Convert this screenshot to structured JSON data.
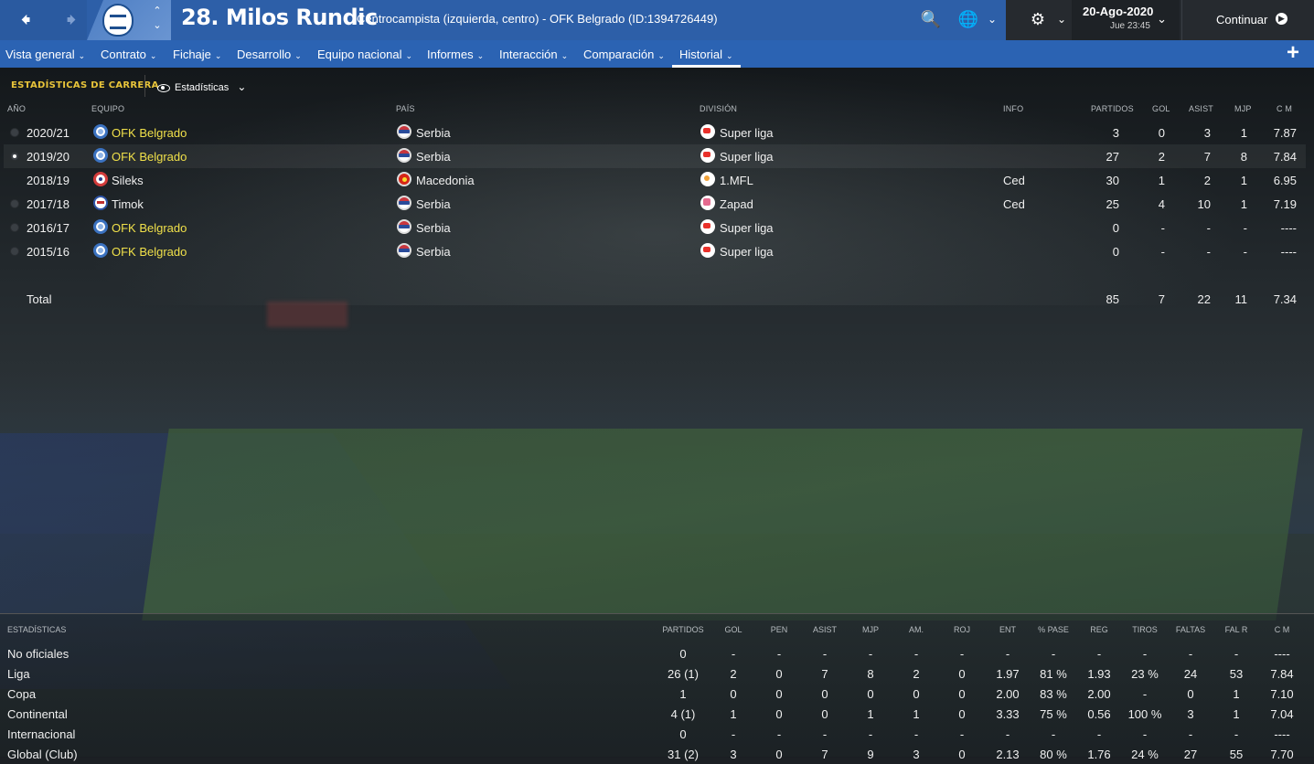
{
  "header": {
    "player_name": "28. Milos Rundic",
    "player_subtitle": "Centrocampista (izquierda, centro) - OFK Belgrado (ID:1394726449)",
    "date": "20-Ago-2020",
    "time": "Jue 23:45",
    "continue_label": "Continuar"
  },
  "menu": {
    "items": [
      "Vista general",
      "Contrato",
      "Fichaje",
      "Desarrollo",
      "Equipo nacional",
      "Informes",
      "Interacción",
      "Comparación",
      "Historial"
    ],
    "active": "Historial"
  },
  "career": {
    "title": "ESTADÍSTICAS DE CARRERA",
    "view": "Estadísticas",
    "columns": {
      "year": "AÑO",
      "team": "EQUIPO",
      "country": "PAÍS",
      "division": "DIVISIÓN",
      "info": "INFO",
      "apps": "PARTIDOS",
      "goals": "GOL",
      "assists": "ASIST",
      "pom": "MJP",
      "avg": "C M"
    },
    "rows": [
      {
        "year": "2020/21",
        "team": "OFK Belgrado",
        "country": "Serbia",
        "division": "Super liga",
        "info": "",
        "apps": "3",
        "goals": "0",
        "assists": "3",
        "pom": "1",
        "avg": "7.87"
      },
      {
        "year": "2019/20",
        "team": "OFK Belgrado",
        "country": "Serbia",
        "division": "Super liga",
        "info": "",
        "apps": "27",
        "goals": "2",
        "assists": "7",
        "pom": "8",
        "avg": "7.84"
      },
      {
        "year": "2018/19",
        "team": "Sileks",
        "country": "Macedonia",
        "division": "1.MFL",
        "info": "Ced",
        "apps": "30",
        "goals": "1",
        "assists": "2",
        "pom": "1",
        "avg": "6.95"
      },
      {
        "year": "2017/18",
        "team": "Timok",
        "country": "Serbia",
        "division": "Zapad",
        "info": "Ced",
        "apps": "25",
        "goals": "4",
        "assists": "10",
        "pom": "1",
        "avg": "7.19"
      },
      {
        "year": "2016/17",
        "team": "OFK Belgrado",
        "country": "Serbia",
        "division": "Super liga",
        "info": "",
        "apps": "0",
        "goals": "-",
        "assists": "-",
        "pom": "-",
        "avg": "----"
      },
      {
        "year": "2015/16",
        "team": "OFK Belgrado",
        "country": "Serbia",
        "division": "Super liga",
        "info": "",
        "apps": "0",
        "goals": "-",
        "assists": "-",
        "pom": "-",
        "avg": "----"
      }
    ],
    "total": {
      "label": "Total",
      "apps": "85",
      "goals": "7",
      "assists": "22",
      "pom": "11",
      "avg": "7.34"
    }
  },
  "stats": {
    "columns": [
      "ESTADÍSTICAS",
      "PARTIDOS",
      "GOL",
      "PEN",
      "ASIST",
      "MJP",
      "AM.",
      "ROJ",
      "ENT",
      "% PASE",
      "REG",
      "TIROS",
      "FALTAS",
      "FAL R",
      "C M"
    ],
    "rows": [
      [
        "No oficiales",
        "0",
        "-",
        "-",
        "-",
        "-",
        "-",
        "-",
        "-",
        "-",
        "-",
        "-",
        "-",
        "-",
        "----"
      ],
      [
        "Liga",
        "26 (1)",
        "2",
        "0",
        "7",
        "8",
        "2",
        "0",
        "1.97",
        "81 %",
        "1.93",
        "23 %",
        "24",
        "53",
        "7.84"
      ],
      [
        "Copa",
        "1",
        "0",
        "0",
        "0",
        "0",
        "0",
        "0",
        "2.00",
        "83 %",
        "2.00",
        "-",
        "0",
        "1",
        "7.10"
      ],
      [
        "Continental",
        "4 (1)",
        "1",
        "0",
        "0",
        "1",
        "1",
        "0",
        "3.33",
        "75 %",
        "0.56",
        "100 %",
        "3",
        "1",
        "7.04"
      ],
      [
        "Internacional",
        "0",
        "-",
        "-",
        "-",
        "-",
        "-",
        "-",
        "-",
        "-",
        "-",
        "-",
        "-",
        "-",
        "----"
      ],
      [
        "Global (Club)",
        "31 (2)",
        "3",
        "0",
        "7",
        "9",
        "3",
        "0",
        "2.13",
        "80 %",
        "1.76",
        "24 %",
        "27",
        "55",
        "7.70"
      ]
    ]
  }
}
